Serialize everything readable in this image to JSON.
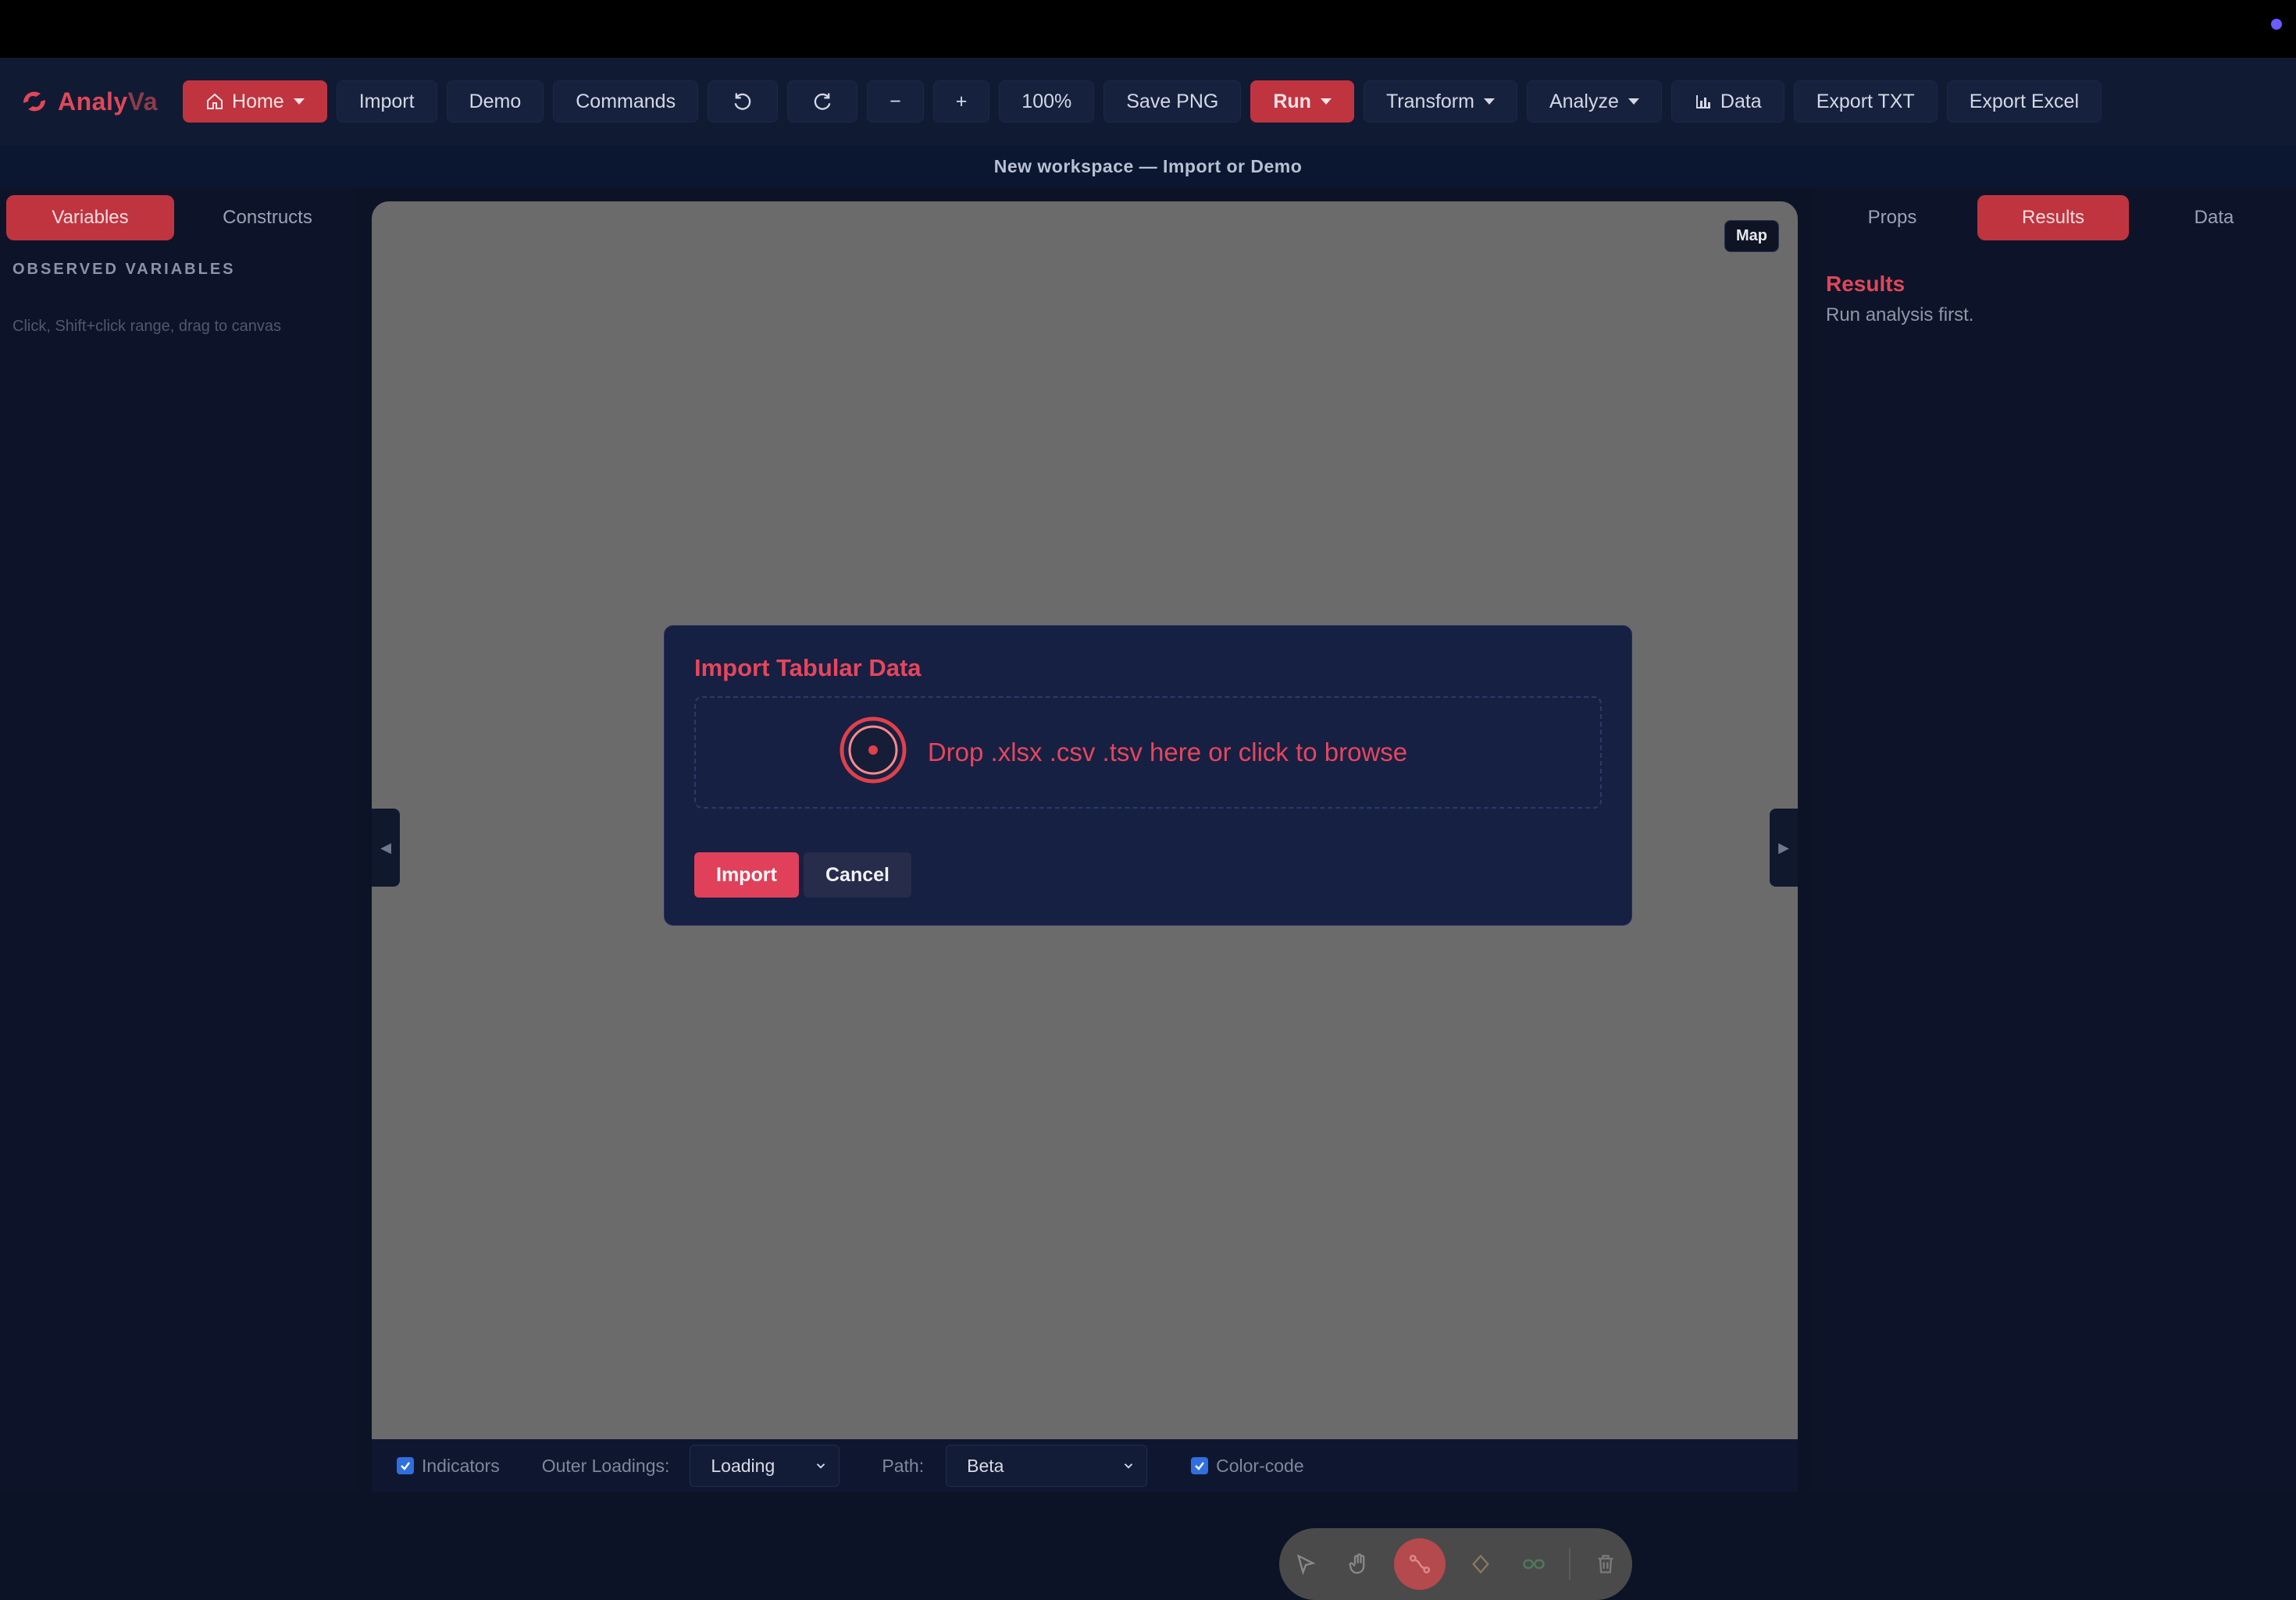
{
  "app": {
    "name_part1": "Analy",
    "name_part2": "Va"
  },
  "toolbar": {
    "home_label": "Home",
    "import_label": "Import",
    "demo_label": "Demo",
    "commands_label": "Commands",
    "zoom_out_label": "−",
    "zoom_in_label": "+",
    "zoom_level": "100%",
    "save_png_label": "Save PNG",
    "run_label": "Run",
    "transform_label": "Transform",
    "analyze_label": "Analyze",
    "data_label": "Data",
    "export_txt_label": "Export TXT",
    "export_excel_label": "Export Excel"
  },
  "banner": {
    "text": "New workspace — Import or Demo"
  },
  "left_panel": {
    "tabs": [
      {
        "label": "Variables",
        "active": true
      },
      {
        "label": "Constructs",
        "active": false
      }
    ],
    "section_title": "OBSERVED VARIABLES",
    "hint": "Click, Shift+click range, drag to canvas"
  },
  "right_panel": {
    "tabs": [
      {
        "label": "Props",
        "active": false
      },
      {
        "label": "Results",
        "active": true
      },
      {
        "label": "Data",
        "active": false
      }
    ],
    "results_title": "Results",
    "results_text": "Run analysis first."
  },
  "canvas": {
    "map_label": "Map",
    "left_handle": "◀",
    "right_handle": "▶"
  },
  "dialog": {
    "title": "Import Tabular Data",
    "dropzone_text": "Drop .xlsx .csv .tsv here or click to browse",
    "import_label": "Import",
    "cancel_label": "Cancel"
  },
  "statusbar": {
    "indicators_label": "Indicators",
    "indicators_checked": true,
    "outer_loadings_label": "Outer Loadings:",
    "outer_loadings_value": "Loading",
    "path_label": "Path:",
    "path_value": "Beta",
    "color_code_label": "Color-code",
    "color_code_checked": true
  },
  "colors": {
    "accent": "#e0475a",
    "active_tab": "#c0343f",
    "dialog_bg": "#162042",
    "canvas": "#6b6b6b"
  }
}
